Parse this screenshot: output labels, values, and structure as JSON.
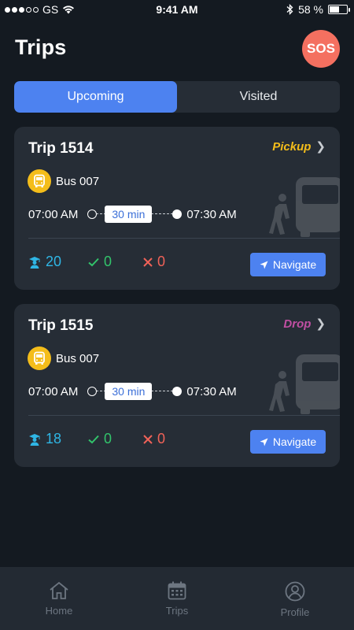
{
  "status_bar": {
    "carrier": "GS",
    "time": "9:41 AM",
    "battery": "58 %",
    "battery_level": 0.58
  },
  "header": {
    "title": "Trips",
    "sos_label": "SOS"
  },
  "tabs": [
    {
      "label": "Upcoming",
      "active": true
    },
    {
      "label": "Visited",
      "active": false
    }
  ],
  "trips": [
    {
      "title": "Trip 1514",
      "type": "Pickup",
      "type_color": "#f4bd1a",
      "bus": "Bus 007",
      "start_time": "07:00 AM",
      "duration": "30 min",
      "end_time": "07:30 AM",
      "students": "20",
      "present": "0",
      "absent": "0",
      "navigate_label": "Navigate"
    },
    {
      "title": "Trip 1515",
      "type": "Drop",
      "type_color": "#c14fa3",
      "bus": "Bus 007",
      "start_time": "07:00 AM",
      "duration": "30 min",
      "end_time": "07:30 AM",
      "students": "18",
      "present": "0",
      "absent": "0",
      "navigate_label": "Navigate"
    }
  ],
  "bottom_nav": [
    {
      "label": "Home",
      "icon": "home-icon"
    },
    {
      "label": "Trips",
      "icon": "calendar-icon"
    },
    {
      "label": "Profile",
      "icon": "profile-icon"
    }
  ],
  "colors": {
    "accent": "#4d82f0",
    "sos": "#f47060",
    "students": "#2fb6e5",
    "present": "#32c46b",
    "absent": "#f06258"
  }
}
